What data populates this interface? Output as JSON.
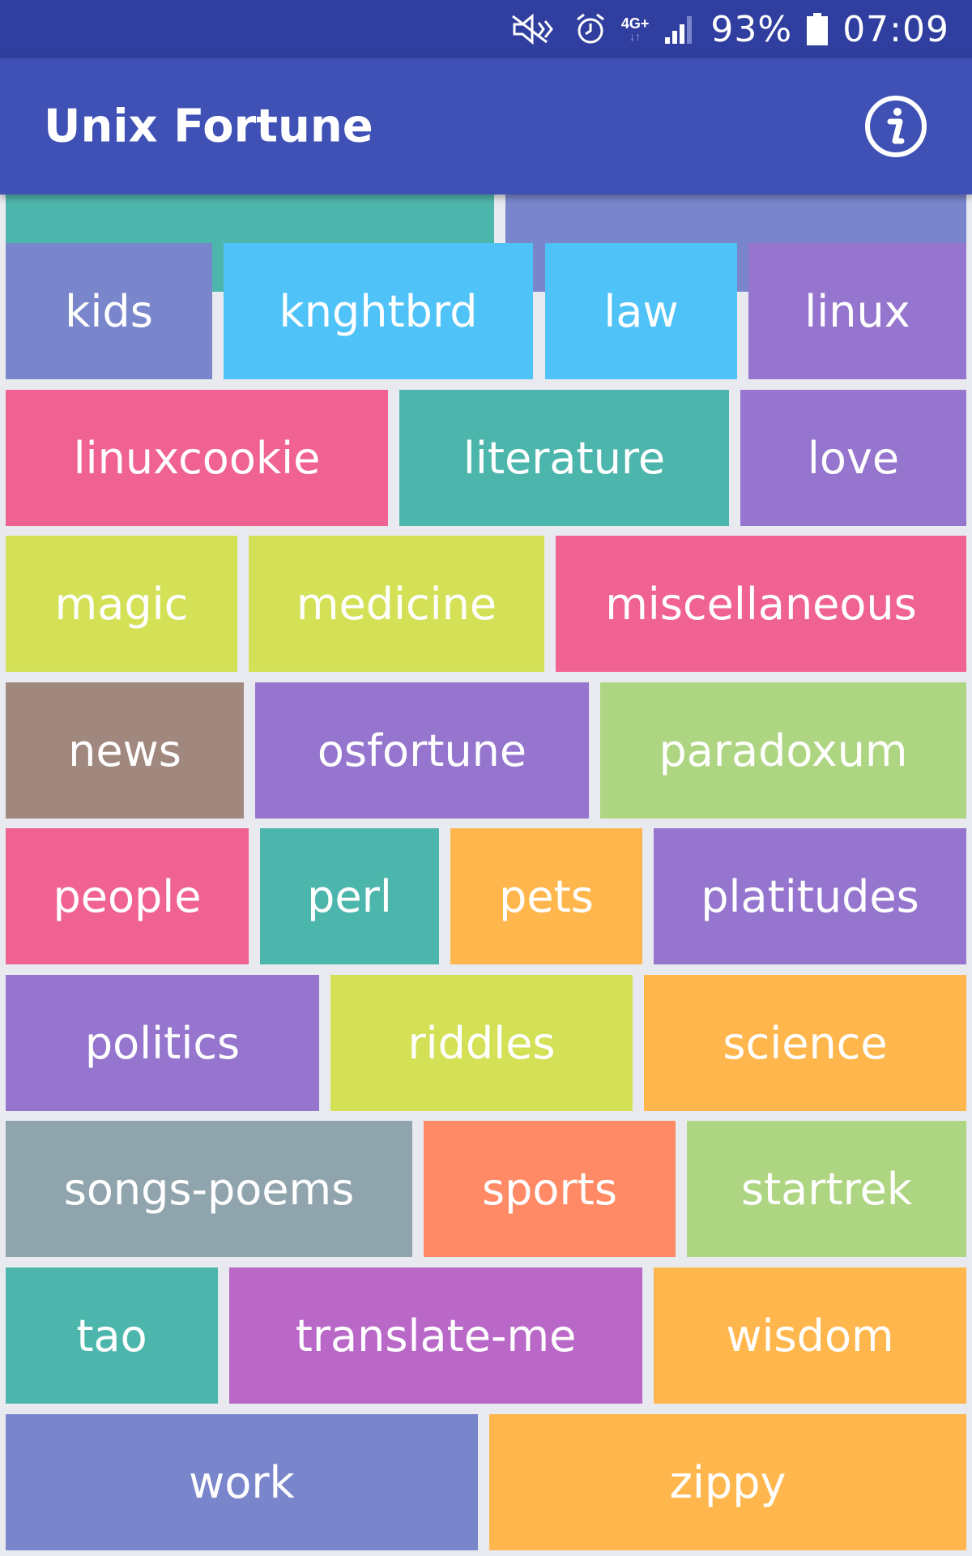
{
  "status_bar": {
    "battery": "93%",
    "time": "07:09",
    "network": "4G+"
  },
  "app_bar": {
    "title": "Unix Fortune",
    "info_icon": "info-icon"
  },
  "colors": {
    "status_bar": "#303f9f",
    "app_bar": "#3f51b5",
    "background": "#e8eaf0"
  },
  "categories": [
    {
      "label": "",
      "color": "#4db6ac"
    },
    {
      "label": "",
      "color": "#7986cb"
    },
    {
      "label": "kids",
      "color": "#7986cb"
    },
    {
      "label": "knghtbrd",
      "color": "#4fc3f7"
    },
    {
      "label": "law",
      "color": "#4fc3f7"
    },
    {
      "label": "linux",
      "color": "#9575cd"
    },
    {
      "label": "linuxcookie",
      "color": "#f06292"
    },
    {
      "label": "literature",
      "color": "#4db6ac"
    },
    {
      "label": "love",
      "color": "#9575cd"
    },
    {
      "label": "magic",
      "color": "#d4e157"
    },
    {
      "label": "medicine",
      "color": "#d4e157"
    },
    {
      "label": "miscellaneous",
      "color": "#f06292"
    },
    {
      "label": "news",
      "color": "#a1887f"
    },
    {
      "label": "osfortune",
      "color": "#9575cd"
    },
    {
      "label": "paradoxum",
      "color": "#aed581"
    },
    {
      "label": "people",
      "color": "#f06292"
    },
    {
      "label": "perl",
      "color": "#4db6ac"
    },
    {
      "label": "pets",
      "color": "#ffb74d"
    },
    {
      "label": "platitudes",
      "color": "#9575cd"
    },
    {
      "label": "politics",
      "color": "#9575cd"
    },
    {
      "label": "riddles",
      "color": "#d4e157"
    },
    {
      "label": "science",
      "color": "#ffb74d"
    },
    {
      "label": "songs-poems",
      "color": "#90a4ae"
    },
    {
      "label": "sports",
      "color": "#ff8a65"
    },
    {
      "label": "startrek",
      "color": "#aed581"
    },
    {
      "label": "tao",
      "color": "#4db6ac"
    },
    {
      "label": "translate-me",
      "color": "#ba68c8"
    },
    {
      "label": "wisdom",
      "color": "#ffb74d"
    },
    {
      "label": "work",
      "color": "#7986cb"
    },
    {
      "label": "zippy",
      "color": "#ffb74d"
    }
  ]
}
